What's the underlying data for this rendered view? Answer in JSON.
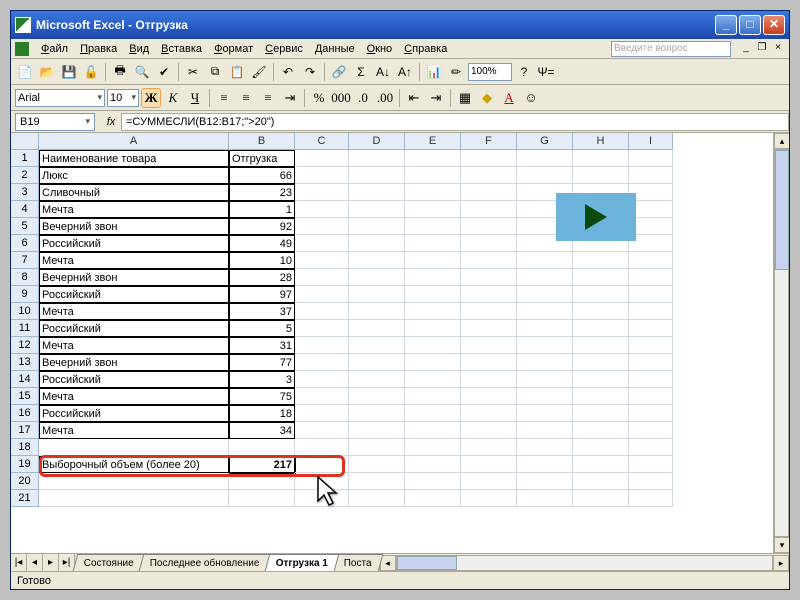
{
  "window": {
    "title": "Microsoft Excel - Отгрузка"
  },
  "menu": {
    "items": [
      "Файл",
      "Правка",
      "Вид",
      "Вставка",
      "Формат",
      "Сервис",
      "Данные",
      "Окно",
      "Справка"
    ],
    "question_placeholder": "Введите вопрос"
  },
  "toolbar": {
    "zoom": "100%"
  },
  "format": {
    "font": "Arial",
    "size": "10"
  },
  "fbar": {
    "namebox": "B19",
    "fx": "fx",
    "formula": "=СУММЕСЛИ(B12:B17;\">20\")"
  },
  "columns": [
    "A",
    "B",
    "C",
    "D",
    "E",
    "F",
    "G",
    "H",
    "I"
  ],
  "rowcount": 21,
  "headers": {
    "A": "Наименование товара",
    "B": "Отгрузка"
  },
  "data": [
    {
      "name": "Люкс",
      "val": "66"
    },
    {
      "name": "Сливочный",
      "val": "23"
    },
    {
      "name": "Мечта",
      "val": "1"
    },
    {
      "name": "Вечерний звон",
      "val": "92"
    },
    {
      "name": "Российский",
      "val": "49"
    },
    {
      "name": "Мечта",
      "val": "10"
    },
    {
      "name": "Вечерний звон",
      "val": "28"
    },
    {
      "name": "Российский",
      "val": "97"
    },
    {
      "name": "Мечта",
      "val": "37"
    },
    {
      "name": "Российский",
      "val": "5"
    },
    {
      "name": "Мечта",
      "val": "31"
    },
    {
      "name": "Вечерний звон",
      "val": "77"
    },
    {
      "name": "Российский",
      "val": "3"
    },
    {
      "name": "Мечта",
      "val": "75"
    },
    {
      "name": "Российский",
      "val": "18"
    },
    {
      "name": "Мечта",
      "val": "34"
    }
  ],
  "summary": {
    "label": "Выборочный объем (более 20)",
    "value": "217"
  },
  "tabs": {
    "nav": [
      "|◂",
      "◂",
      "▸",
      "▸|"
    ],
    "list": [
      "Состояние",
      "Последнее обновление",
      "Отгрузка 1",
      "Поста"
    ],
    "active": 2
  },
  "status": "Готово",
  "chart_data": {
    "type": "table",
    "title": "Отгрузка",
    "columns": [
      "Наименование товара",
      "Отгрузка"
    ],
    "rows": [
      [
        "Люкс",
        66
      ],
      [
        "Сливочный",
        23
      ],
      [
        "Мечта",
        1
      ],
      [
        "Вечерний звон",
        92
      ],
      [
        "Российский",
        49
      ],
      [
        "Мечта",
        10
      ],
      [
        "Вечерний звон",
        28
      ],
      [
        "Российский",
        97
      ],
      [
        "Мечта",
        37
      ],
      [
        "Российский",
        5
      ],
      [
        "Мечта",
        31
      ],
      [
        "Вечерний звон",
        77
      ],
      [
        "Российский",
        3
      ],
      [
        "Мечта",
        75
      ],
      [
        "Российский",
        18
      ],
      [
        "Мечта",
        34
      ]
    ],
    "summary": {
      "label": "Выборочный объем (более 20)",
      "value": 217,
      "formula": "=СУММЕСЛИ(B12:B17;\">20\")"
    }
  }
}
